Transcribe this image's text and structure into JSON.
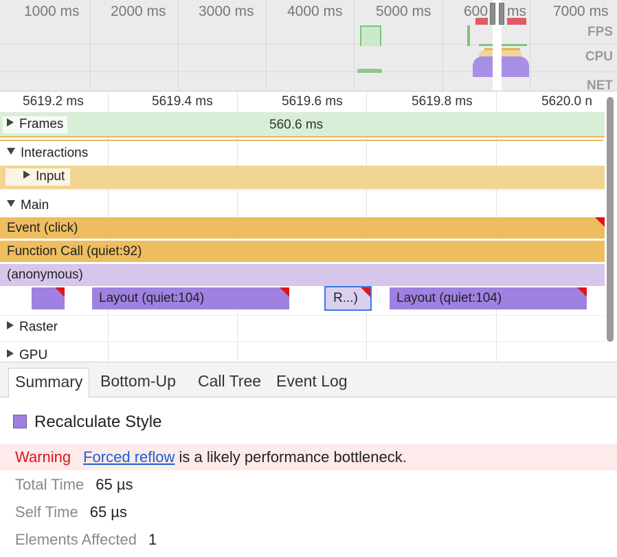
{
  "overview": {
    "ticks": [
      "1000 ms",
      "2000 ms",
      "3000 ms",
      "4000 ms",
      "5000 ms",
      "600",
      "ms",
      "7000 ms"
    ],
    "track_labels": [
      "FPS",
      "CPU",
      "NET"
    ]
  },
  "flame": {
    "ticks": [
      "5619.2 ms",
      "5619.4 ms",
      "5619.6 ms",
      "5619.8 ms",
      "5620.0 n"
    ],
    "frames": {
      "label": "Frames",
      "duration": "560.6 ms"
    },
    "interactions": {
      "label": "Interactions",
      "child": "Input"
    },
    "main": {
      "label": "Main",
      "event_label": "Event (click)",
      "function_label": "Function Call (quiet:92)",
      "anonymous_label": "(anonymous)",
      "layout1_label": "Layout (quiet:104)",
      "recalc_label": "R...)",
      "layout2_label": "Layout (quiet:104)"
    },
    "raster": {
      "label": "Raster"
    },
    "gpu": {
      "label": "GPU"
    }
  },
  "tabs": [
    {
      "label": "Summary",
      "active": true
    },
    {
      "label": "Bottom-Up"
    },
    {
      "label": "Call Tree"
    },
    {
      "label": "Event Log"
    }
  ],
  "summary": {
    "title": "Recalculate Style",
    "swatch_color": "#9e81e0",
    "warning_label": "Warning",
    "warning_link": "Forced reflow",
    "warning_text": " is a likely performance bottleneck.",
    "rows": [
      {
        "key": "Total Time",
        "value": "65 µs"
      },
      {
        "key": "Self Time",
        "value": "65 µs"
      },
      {
        "key": "Elements Affected",
        "value": "1"
      }
    ]
  },
  "colors": {
    "frames": "#d7efd6",
    "input": "#f2d593",
    "event": "#edbd5f",
    "anonymous": "#d7c6ec",
    "layout": "#9e81e0",
    "selection": "#3b78e7",
    "warning": "#e0151a"
  }
}
